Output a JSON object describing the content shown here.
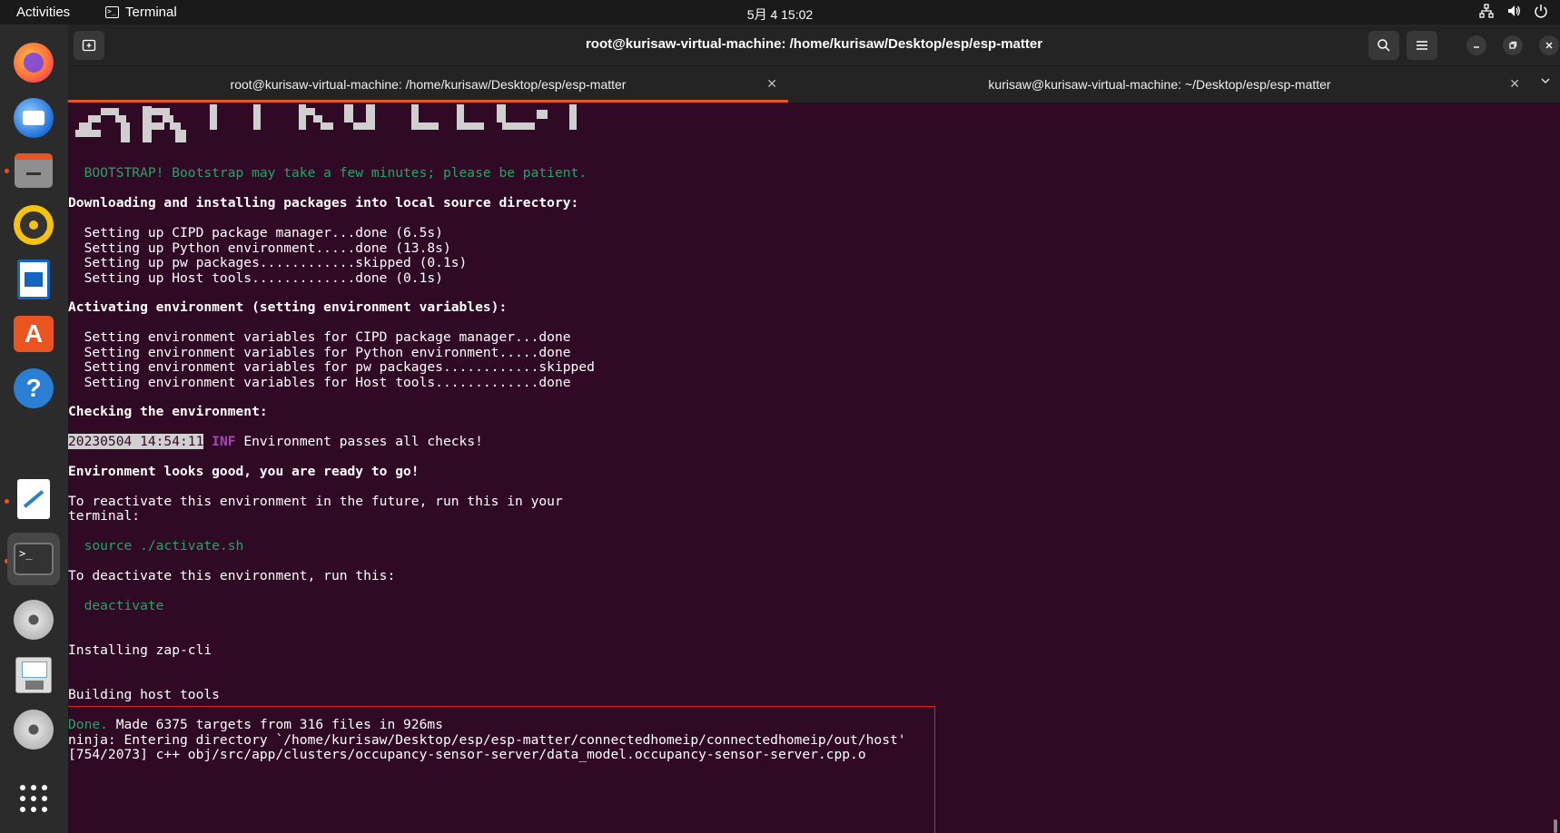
{
  "topbar": {
    "activities": "Activities",
    "app_name": "Terminal",
    "clock": "5月 4  15:02",
    "tray_icons": [
      "network-icon",
      "volume-icon",
      "power-icon"
    ]
  },
  "dock": {
    "items": [
      "firefox",
      "thunderbird",
      "files",
      "rhythmbox",
      "libreoffice-writer",
      "app-center",
      "help",
      "text-editor",
      "terminal",
      "dvd-drive",
      "floppy-drive",
      "dvd-drive-2",
      "show-apps"
    ]
  },
  "window": {
    "title": "root@kurisaw-virtual-machine: /home/kurisaw/Desktop/esp/esp-matter",
    "tabs": [
      {
        "label": "root@kurisaw-virtual-machine: /home/kurisaw/Desktop/esp/esp-matter",
        "active": true
      },
      {
        "label": "kurisaw@kurisaw-virtual-machine: ~/Desktop/esp/esp-matter",
        "active": false
      }
    ]
  },
  "terminal": {
    "bootstrap": "  BOOTSTRAP! Bootstrap may take a few minutes; please be patient.",
    "downloading": "Downloading and installing packages into local source directory:",
    "setup": [
      "  Setting up CIPD package manager...done (6.5s)",
      "  Setting up Python environment.....done (13.8s)",
      "  Setting up pw packages............skipped (0.1s)",
      "  Setting up Host tools.............done (0.1s)"
    ],
    "activating": "Activating environment (setting environment variables):",
    "envvars": [
      "  Setting environment variables for CIPD package manager...done",
      "  Setting environment variables for Python environment.....done",
      "  Setting environment variables for pw packages............skipped",
      "  Setting environment variables for Host tools.............done"
    ],
    "checking": "Checking the environment:",
    "timestamp": "20230504 14:54:11",
    "inf": "INF",
    "passes": " Environment passes all checks!",
    "good": "Environment looks good, you are ready to go!",
    "reactivate_1": "To reactivate this environment in the future, run this in your",
    "reactivate_2": "terminal:",
    "source_cmd": "  source ./activate.sh",
    "deactivate_hint": "To deactivate this environment, run this:",
    "deactivate_cmd": "  deactivate",
    "installing": "Installing zap-cli",
    "building": "Building host tools",
    "done_word": "Done.",
    "done_rest": " Made 6375 targets from 316 files in 926ms",
    "ninja": "ninja: Entering directory `/home/kurisaw/Desktop/esp/esp-matter/connectedhomeip/connectedhomeip/out/host'",
    "progress": "[754/2073] c++ obj/src/app/clusters/occupancy-sensor-server/data_model.occupancy-sensor-server.cpp.o"
  },
  "colors": {
    "terminal_bg": "#300a24",
    "green": "#26a269",
    "accent": "#e95420",
    "inf": "#a347ba",
    "redbox": "#e01b24"
  }
}
